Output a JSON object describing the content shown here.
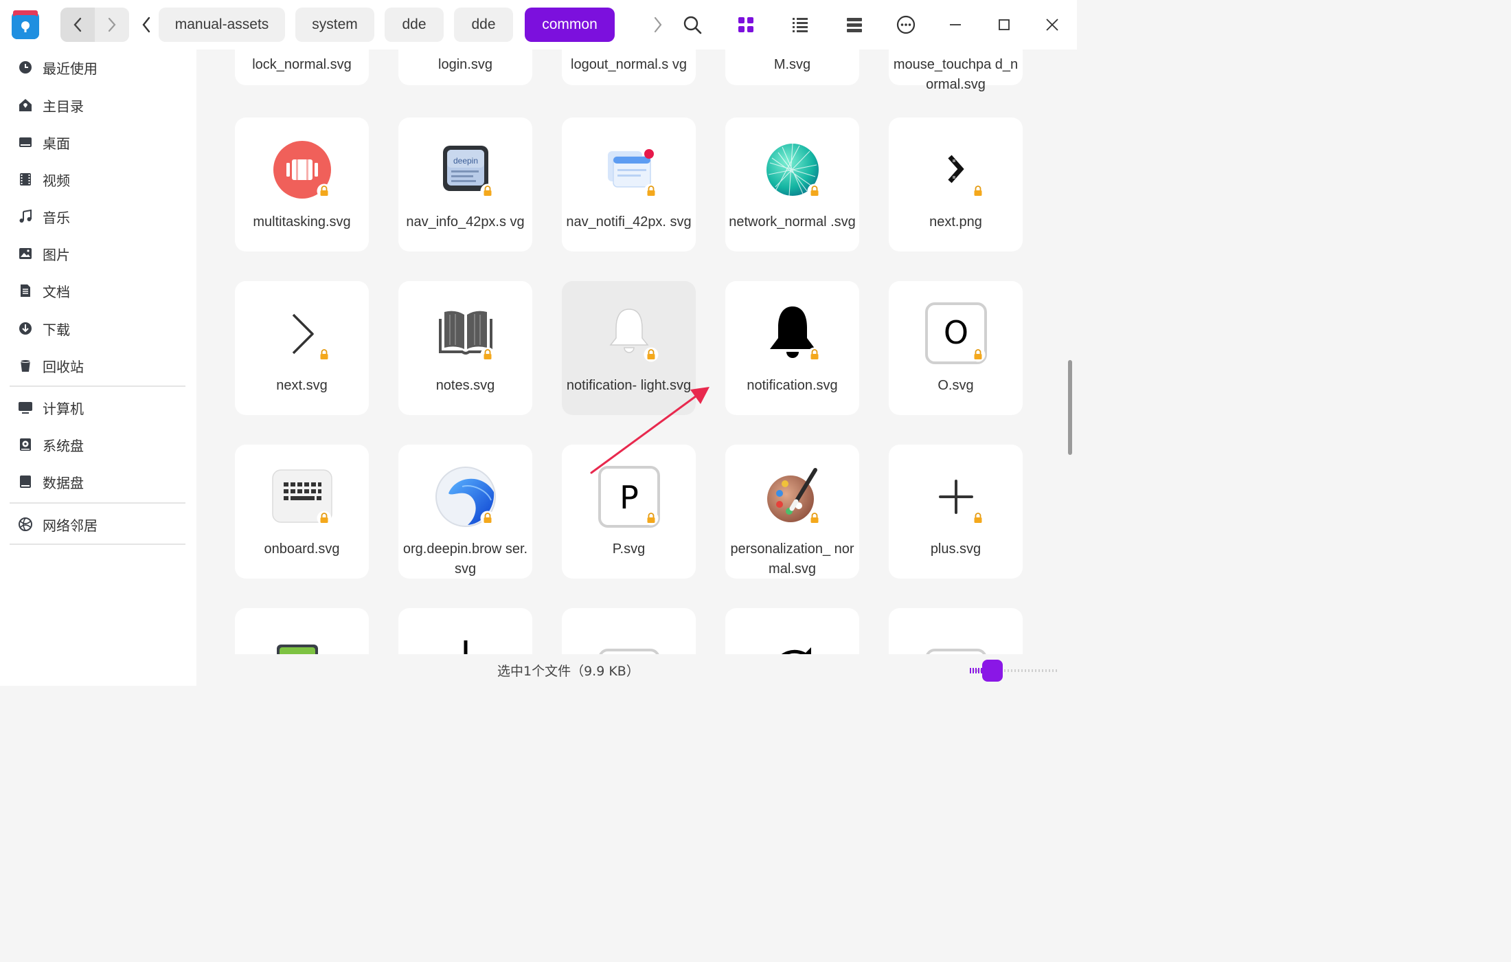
{
  "titlebar": {
    "breadcrumbs": [
      "manual-assets",
      "system",
      "dde",
      "dde",
      "common"
    ]
  },
  "sidebar": {
    "items": [
      {
        "label": "最近使用",
        "icon": "clock-icon"
      },
      {
        "label": "主目录",
        "icon": "home-icon"
      },
      {
        "label": "桌面",
        "icon": "desktop-icon"
      },
      {
        "label": "视频",
        "icon": "video-icon"
      },
      {
        "label": "音乐",
        "icon": "music-icon"
      },
      {
        "label": "图片",
        "icon": "picture-icon"
      },
      {
        "label": "文档",
        "icon": "document-icon"
      },
      {
        "label": "下载",
        "icon": "download-icon"
      },
      {
        "label": "回收站",
        "icon": "trash-icon"
      }
    ],
    "devices": [
      {
        "label": "计算机",
        "icon": "computer-icon"
      },
      {
        "label": "系统盘",
        "icon": "system-disk-icon"
      },
      {
        "label": "数据盘",
        "icon": "data-disk-icon"
      }
    ],
    "network": [
      {
        "label": "网络邻居",
        "icon": "network-neighborhood-icon"
      }
    ]
  },
  "files": {
    "row0": [
      "lock_normal.svg",
      "login.svg",
      "logout_normal.s vg",
      "M.svg",
      "mouse_touchpa d_normal.svg"
    ],
    "row1": [
      "multitasking.svg",
      "nav_info_42px.s vg",
      "nav_notifi_42px. svg",
      "network_normal .svg",
      "next.png"
    ],
    "row2": [
      "next.svg",
      "notes.svg",
      "notification- light.svg",
      "notification.svg",
      "O.svg"
    ],
    "row3": [
      "onboard.svg",
      "org.deepin.brow ser.svg",
      "P.svg",
      "personalization_ normal.svg",
      "plus.svg"
    ]
  },
  "status": {
    "text": "选中1个文件（9.9 KB）"
  },
  "colors": {
    "accent": "#7c10dd",
    "annotation_arrow": "#e8294e"
  }
}
